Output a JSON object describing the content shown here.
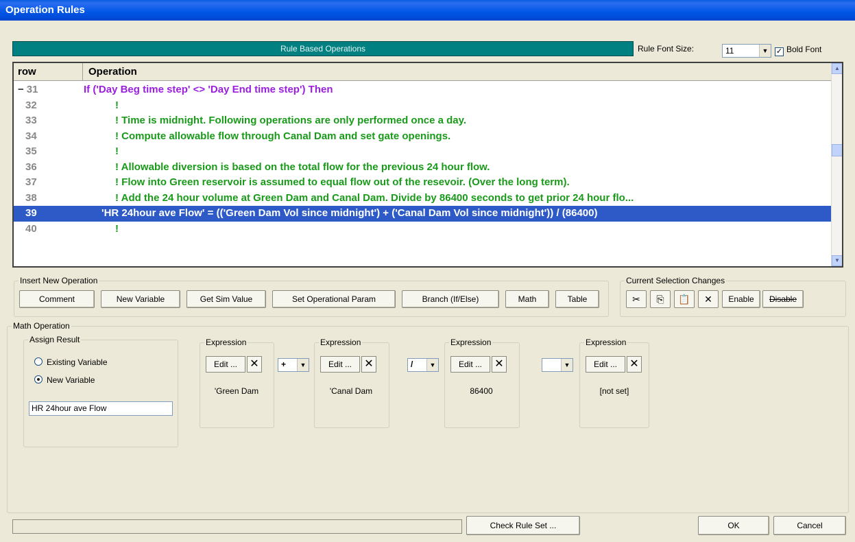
{
  "window": {
    "title": "Operation Rules"
  },
  "header": {
    "band_label": "Rule Based Operations",
    "font_size_label": "Rule Font Size:",
    "font_size_value": "11",
    "bold_font_label": "Bold Font",
    "bold_font_checked": "✓"
  },
  "grid": {
    "columns": [
      "row",
      "Operation"
    ],
    "rows": [
      {
        "num": "31",
        "collapse": "−",
        "op": "If ('Day Beg time step' <> 'Day End time step') Then",
        "kind": "cond"
      },
      {
        "num": "32",
        "op": "!",
        "kind": "comment"
      },
      {
        "num": "33",
        "op": "! Time is midnight.  Following operations are only performed once a day.",
        "kind": "comment"
      },
      {
        "num": "34",
        "op": "! Compute allowable flow through Canal Dam and set gate openings.",
        "kind": "comment"
      },
      {
        "num": "35",
        "op": "!",
        "kind": "comment"
      },
      {
        "num": "36",
        "op": "! Allowable diversion is based on the total flow for the previous 24 hour flow.",
        "kind": "comment"
      },
      {
        "num": "37",
        "op": "! Flow into Green reservoir is assumed to equal flow out of the resevoir.  (Over the long term).",
        "kind": "comment"
      },
      {
        "num": "38",
        "op": "! Add the 24 hour volume at Green Dam and Canal Dam.  Divide by 86400 seconds to get prior 24 hour flo...",
        "kind": "comment"
      },
      {
        "num": "39",
        "op": "'HR 24hour ave Flow' = (('Green Dam Vol since midnight') + ('Canal Dam Vol since midnight')) / (86400)",
        "kind": "selected"
      },
      {
        "num": "40",
        "op": "!",
        "kind": "comment"
      }
    ]
  },
  "insert_group": {
    "legend": "Insert New Operation",
    "buttons": [
      "Comment",
      "New Variable",
      "Get Sim Value",
      "Set Operational Param",
      "Branch (If/Else)",
      "Math",
      "Table"
    ]
  },
  "selection_group": {
    "legend": "Current Selection Changes",
    "enable": "Enable",
    "disable": "Disable"
  },
  "math": {
    "legend": "Math Operation",
    "assign": {
      "legend": "Assign Result",
      "existing": "Existing Variable",
      "new": "New Variable",
      "value": "HR 24hour ave Flow"
    },
    "edit_label": "Edit ...",
    "expressions": [
      {
        "legend": "Expression",
        "label": "'Green Dam"
      },
      {
        "legend": "Expression",
        "label": "'Canal Dam"
      },
      {
        "legend": "Expression",
        "label": "86400"
      },
      {
        "legend": "Expression",
        "label": "[not set]"
      }
    ],
    "operators": [
      "+",
      "/",
      ""
    ]
  },
  "footer": {
    "check": "Check Rule Set ...",
    "ok": "OK",
    "cancel": "Cancel"
  }
}
